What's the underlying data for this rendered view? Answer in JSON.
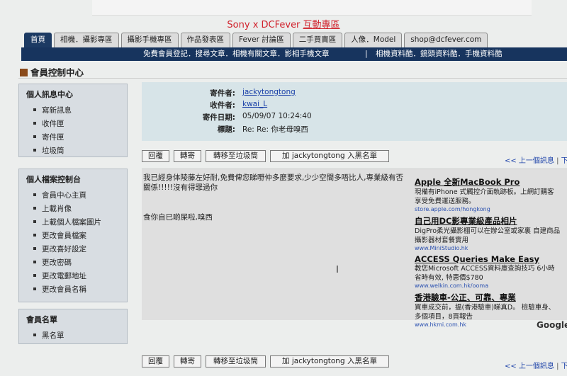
{
  "promo": {
    "text": "Sony x DCFever ",
    "link": "互動專區"
  },
  "tabs": [
    "首頁",
    "相機．攝影專區",
    "攝影手機專區",
    "作品發表區",
    "Fever 討論區",
    "二手買賣區",
    "人像．Model",
    "shop@dcfever.com"
  ],
  "navbar": {
    "left": "免費會員登記．搜尋文章．相機有關文章．影相手機文章",
    "separator": "|",
    "right": "相機資料酷．鏡頭資料酷．手機資料酷"
  },
  "page_title": "會員控制中心",
  "sidebar": {
    "personal": {
      "title": "個人訊息中心",
      "items": [
        "寫新訊息",
        "收件匣",
        "寄件匣",
        "垃圾筒"
      ]
    },
    "profile": {
      "title": "個人檔案控制台",
      "items": [
        "會員中心主頁",
        "上載肖像",
        "上載個人檔案圖片",
        "更改會員檔案",
        "更改喜好設定",
        "更改密碼",
        "更改電郵地址",
        "更改會員名稱"
      ]
    },
    "list": {
      "title": "會員名單",
      "items": [
        "黑名單"
      ]
    }
  },
  "message": {
    "sender_label": "寄件者:",
    "sender": "jackytongtong",
    "recipient_label": "收件者:",
    "recipient": "kwai_L",
    "date_label": "寄件日期:",
    "date": "05/09/07 10:24:40",
    "subject_label": "標題:",
    "subject": "Re: Re: 你老母嗅西",
    "body_line1": "我已經身体陵藤左好耐,免費俾您睇嘢仲多麼要求,少少空間多唔比人,專業級有否關係!!!!!沒有得罪過你",
    "body_line2": "食你自已啲屎啦,嗅西"
  },
  "actions": {
    "reply": "回覆",
    "forward": "轉寄",
    "trash": "轉移至垃圾筒",
    "block": "加 jackytongtong 入黑名單",
    "prev": "<< 上一個訊息",
    "sep": " | ",
    "next": "下一"
  },
  "ads": [
    {
      "title": "Apple 全新MacBook Pro",
      "desc": [
        "現備有iPhone 式觸控介面軌跡板。上網訂購客",
        "享受免費運送服務。"
      ],
      "url": "store.apple.com/hongkong"
    },
    {
      "title": "自己用DC影專業級產品相片",
      "desc": [
        "DigPro柔光攝影棚可以在辦公室或家裏 自建商品",
        "攝影器材套餐實用"
      ],
      "url": "www.MiniStudio.hk"
    },
    {
      "title": "ACCESS Queries Make Easy",
      "desc": [
        "教您Microsoft ACCESS資料庫查詢技巧 6小時",
        "省時有效, 特惠價$780"
      ],
      "url": "www.welkin.com.hk/ooma"
    },
    {
      "title": "香港驗車-公正、可靠、專業",
      "desc": [
        "買車成交前，揾(香港驗車)睇真D。 檢驗車身、",
        "多個項目，8頁報告"
      ],
      "url": "www.hkmi.com.hk"
    }
  ],
  "google_label": "Google"
}
